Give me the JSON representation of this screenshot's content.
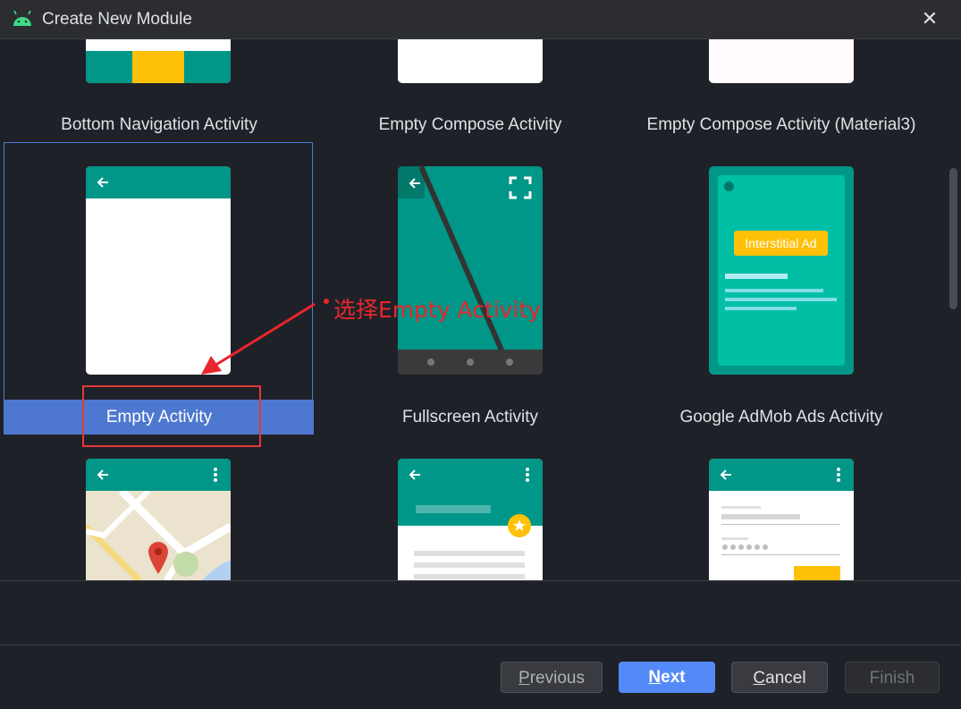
{
  "window": {
    "title": "Create New Module",
    "close_glyph": "✕"
  },
  "gallery": {
    "row1": [
      "Bottom Navigation Activity",
      "Empty Compose Activity",
      "Empty Compose Activity (Material3)"
    ],
    "row2": [
      "Empty Activity",
      "Fullscreen Activity",
      "Google AdMob Ads Activity"
    ],
    "admob_badge": "Interstitial Ad",
    "selected": "Empty Activity"
  },
  "annotation": {
    "text": "选择Empty Activity",
    "color": "#e8262b"
  },
  "buttons": {
    "previous_u": "P",
    "previous_rest": "revious",
    "next_u": "N",
    "next_rest": "ext",
    "cancel_u": "C",
    "cancel_rest": "ancel",
    "finish": "Finish"
  },
  "colors": {
    "accent": "#548af7",
    "selection": "#4e78cf",
    "teal": "#009688",
    "admob_teal": "#00bfa5",
    "amber": "#ffc107"
  },
  "icons": [
    "android-icon",
    "close-icon",
    "back-arrow-icon",
    "fullscreen-icon",
    "more-vert-icon",
    "star-icon",
    "map-pin-icon"
  ]
}
